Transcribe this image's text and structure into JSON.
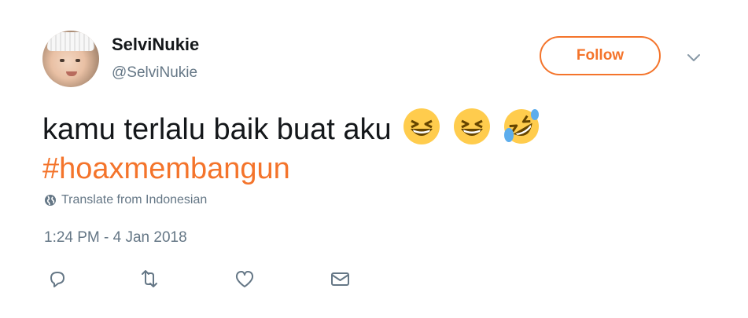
{
  "user": {
    "display_name": "SelviNukie",
    "handle": "@SelviNukie"
  },
  "header": {
    "follow_label": "Follow"
  },
  "tweet": {
    "text": "kamu terlalu baik buat aku",
    "emojis": [
      "grinning-squinting-face",
      "grinning-squinting-face",
      "rolling-on-floor-laughing"
    ],
    "hashtag": "#hoaxmembangun",
    "translate_label": "Translate from Indonesian",
    "timestamp": "1:24 PM - 4 Jan 2018"
  },
  "actions": [
    "reply-icon",
    "retweet-icon",
    "like-icon",
    "message-icon"
  ],
  "colors": {
    "accent": "#f4742b",
    "secondary_text": "#657786",
    "primary_text": "#14171a"
  }
}
